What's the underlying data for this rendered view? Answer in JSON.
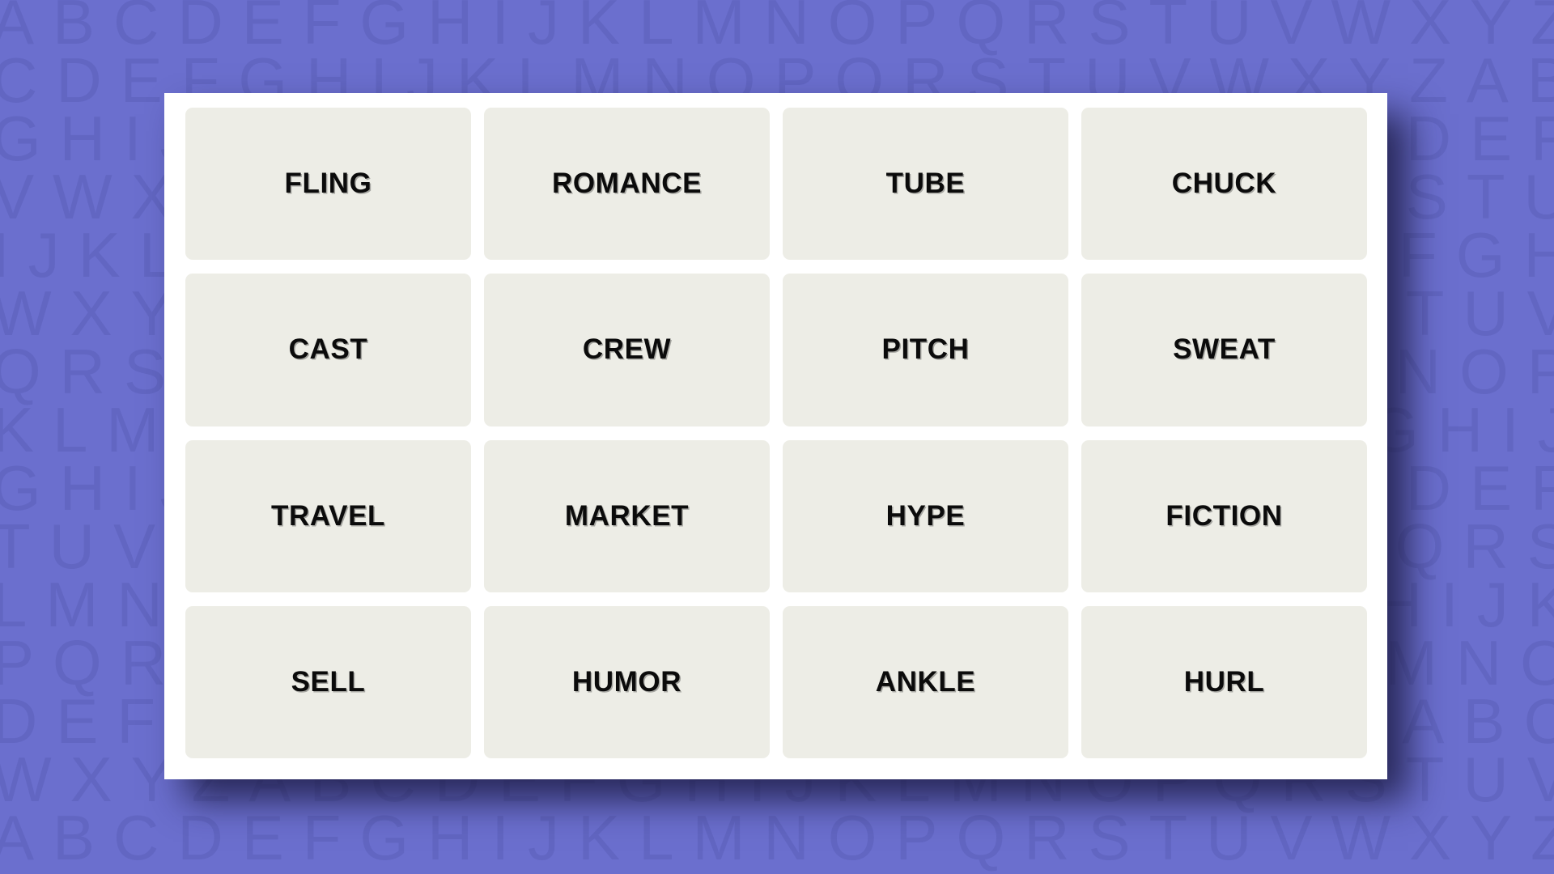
{
  "theme": {
    "background_color": "#6b6fce",
    "pattern_letter_color": "#6266c2",
    "panel_color": "#ffffff",
    "card_color": "#edede6",
    "card_text_color": "#0b0b0b",
    "shadow_color": "#18163c"
  },
  "background": {
    "pattern_name": "alphabet-tile-pattern",
    "rows": [
      "ABCDEFGHIJKLMNOPQRSTUVWXYZABCDEFG",
      "CDEFGHIJKLMNOPQRSTUVWXYZABCDEFGHI",
      "GHIJKLMNOPQRSTUVWXYZABCDEFGHIJKLM",
      "VWXYZABCDEFGHIJKLMNOPQRSTUVWXYZAB",
      "IJKLMNOPQRSTUVWXYZABCDEFGHIJKLMNO",
      "WXYZABCDEFGHIJKLMNOPQRSTUVWXYZABC",
      "QRSTUVWXYZABCDEFGHIJKLMNOPQRSTUVW",
      "KLMNOPQRSTUVWXYZABCDEFGHIJKLMNOPQ",
      "GHIJKLMNOPQRSTUVWXYZABCDEFGHIJKLM",
      "TUVWXYZABCDEFGHIJKLMNOPQRSTUVWXYZ",
      "LMNOPQRSTUVWXYZABCDEFGHIJKLMNOPQR",
      "PQRSTUVWXYZABCDEFGHIJKLMNOPQRSTUV",
      "DEFGHIJKLMNOPQRSTUVWXYZABCDEFGHIJ",
      "WXYZABCDEFGHIJKLMNOPQRSTUVWXYZABC",
      "ABCDEFGHIJKLMNOPQRSTUVWXYZABCDEFG"
    ]
  },
  "board": {
    "columns": 4,
    "rows": 4,
    "tiles": [
      {
        "word": "FLING",
        "row": 1,
        "col": 1,
        "selected": false
      },
      {
        "word": "ROMANCE",
        "row": 1,
        "col": 2,
        "selected": false
      },
      {
        "word": "TUBE",
        "row": 1,
        "col": 3,
        "selected": false
      },
      {
        "word": "CHUCK",
        "row": 1,
        "col": 4,
        "selected": false
      },
      {
        "word": "CAST",
        "row": 2,
        "col": 1,
        "selected": false
      },
      {
        "word": "CREW",
        "row": 2,
        "col": 2,
        "selected": false
      },
      {
        "word": "PITCH",
        "row": 2,
        "col": 3,
        "selected": false
      },
      {
        "word": "SWEAT",
        "row": 2,
        "col": 4,
        "selected": false
      },
      {
        "word": "TRAVEL",
        "row": 3,
        "col": 1,
        "selected": false
      },
      {
        "word": "MARKET",
        "row": 3,
        "col": 2,
        "selected": false
      },
      {
        "word": "HYPE",
        "row": 3,
        "col": 3,
        "selected": false
      },
      {
        "word": "FICTION",
        "row": 3,
        "col": 4,
        "selected": false
      },
      {
        "word": "SELL",
        "row": 4,
        "col": 1,
        "selected": false
      },
      {
        "word": "HUMOR",
        "row": 4,
        "col": 2,
        "selected": false
      },
      {
        "word": "ANKLE",
        "row": 4,
        "col": 3,
        "selected": false
      },
      {
        "word": "HURL",
        "row": 4,
        "col": 4,
        "selected": false
      }
    ]
  }
}
